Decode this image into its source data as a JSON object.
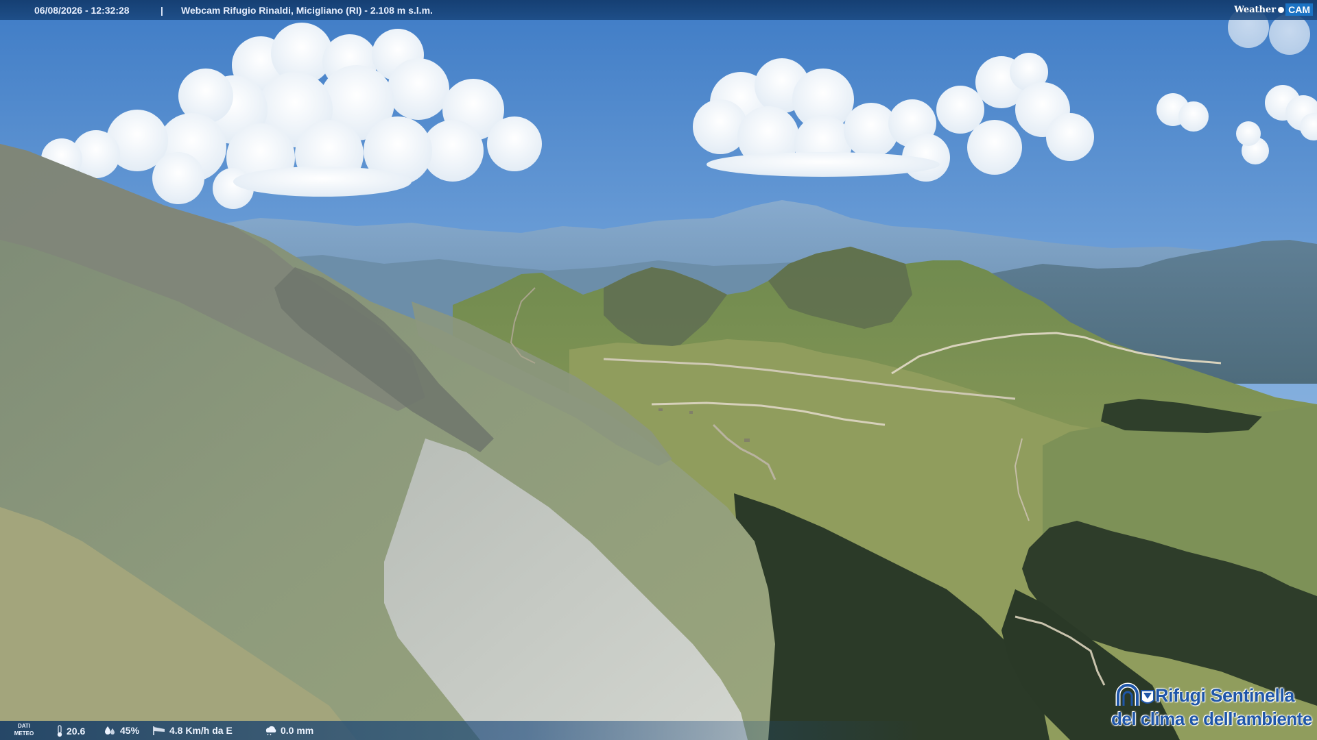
{
  "overlay": {
    "timestamp": "06/08/2026 - 12:32:28",
    "separator": "|",
    "title": "Webcam Rifugio Rinaldi, Micigliano (RI) - 2.108 m s.l.m.",
    "brand_weather": "Weather",
    "brand_cam": "CAM"
  },
  "weather": {
    "label": "DATI METEO",
    "temperature": "20.6",
    "humidity": "45%",
    "wind": "4.8 Km/h da E",
    "rain": "0.0 mm"
  },
  "logo": {
    "line1": "Rifugi Sentinella",
    "line2": "del clima e dell'ambiente"
  },
  "colors": {
    "sky": "#5b8cc9",
    "bar": "#143a6c",
    "logo_blue": "#1f56a8"
  }
}
